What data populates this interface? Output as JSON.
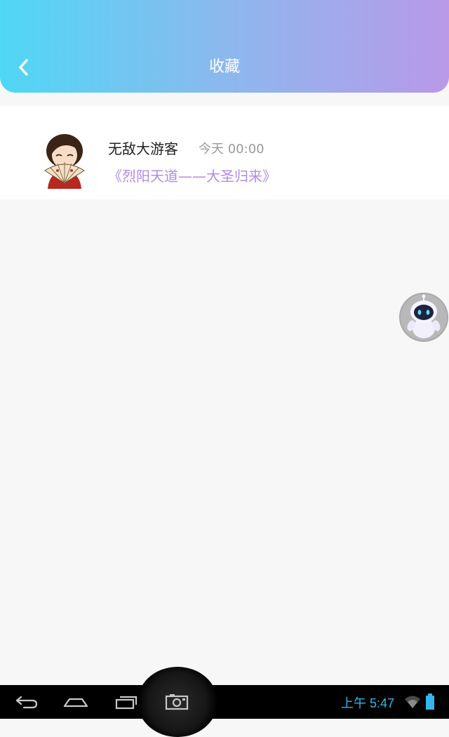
{
  "header": {
    "title": "收藏"
  },
  "favorites": [
    {
      "author": "无敌大游客",
      "time": "今天 00:00",
      "book_title": "《烈阳天道——大圣归来》"
    }
  ],
  "status_bar": {
    "clock": "上午 5:47"
  },
  "colors": {
    "header_gradient_start": "#4fd7f5",
    "header_gradient_end": "#b999e9",
    "book_title": "#b28be6",
    "clock": "#36b5ea"
  },
  "icons": {
    "back": "chevron-left-icon",
    "floating": "robot-icon",
    "nav_back": "back-arrow-icon",
    "nav_home": "home-icon",
    "nav_recent": "recent-apps-icon",
    "nav_screenshot": "camera-icon",
    "wifi": "wifi-icon",
    "battery": "battery-icon"
  }
}
